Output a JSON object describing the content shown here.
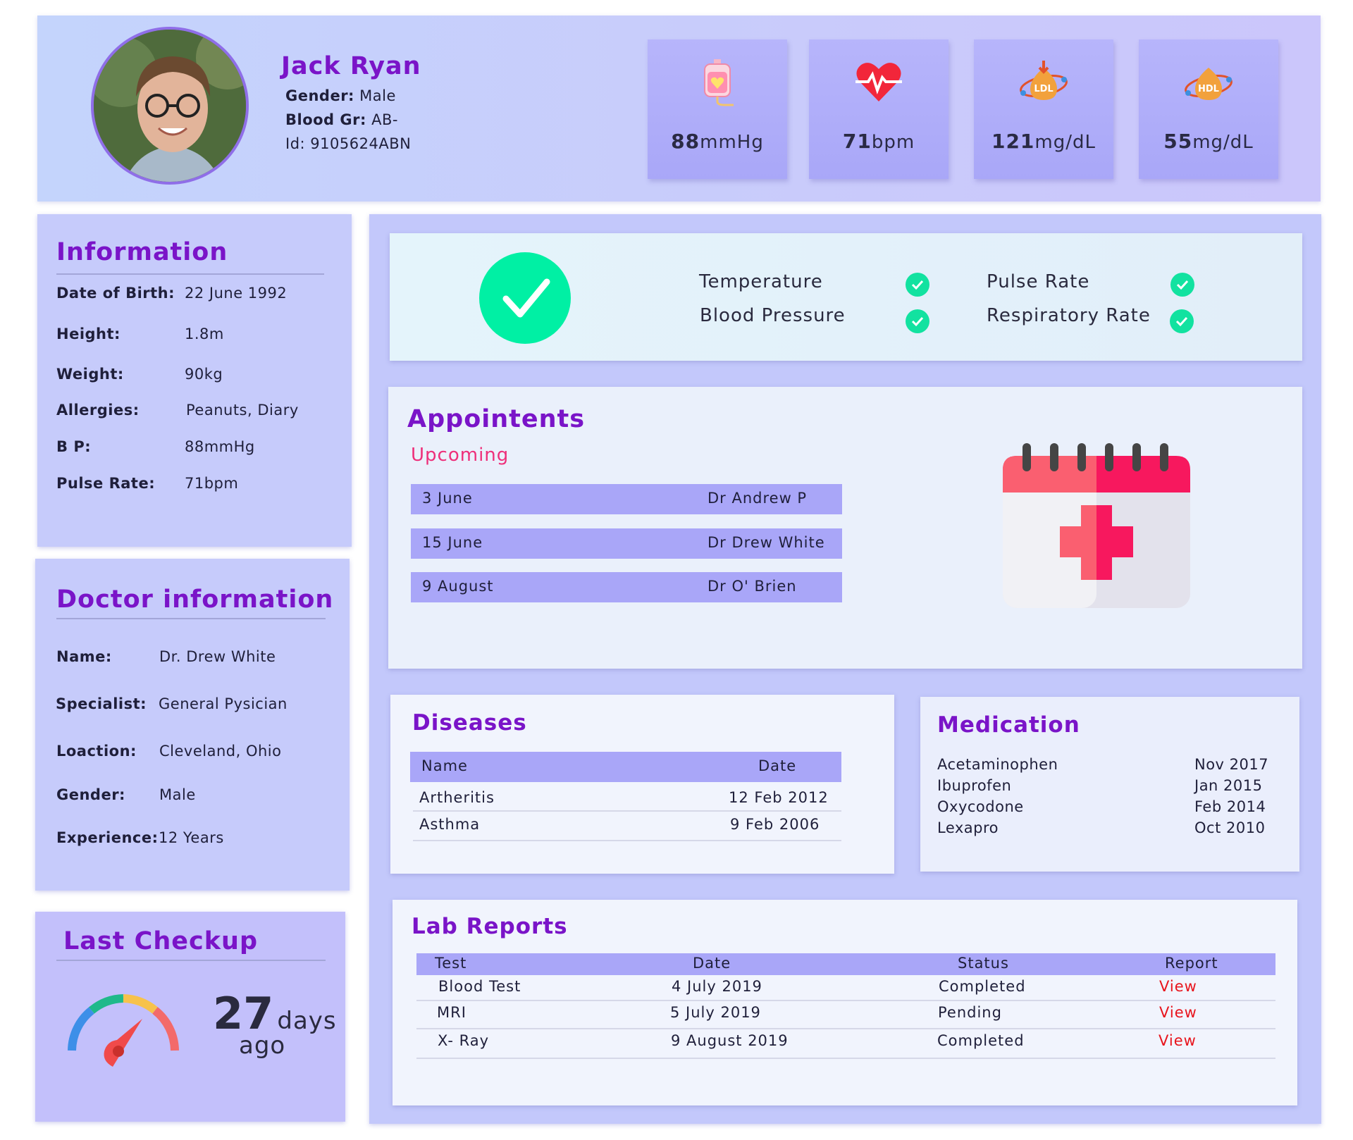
{
  "patient": {
    "name": "Jack Ryan",
    "gender_label": "Gender:",
    "gender": "Male",
    "blood_label": "Blood Gr:",
    "blood_group": "AB-",
    "id_label": "Id:",
    "id": "9105624ABN"
  },
  "vitals": [
    {
      "icon": "blood-bag-icon",
      "value": "88",
      "unit": "mmHg"
    },
    {
      "icon": "heart-pulse-icon",
      "value": "71",
      "unit": "bpm"
    },
    {
      "icon": "ldl-icon",
      "icon_text": "LDL",
      "value": "121",
      "unit": "mg/dL"
    },
    {
      "icon": "hdl-icon",
      "icon_text": "HDL",
      "value": "55",
      "unit": "mg/dL"
    }
  ],
  "information": {
    "title": "Information",
    "rows": [
      {
        "label": "Date of Birth:",
        "value": "22 June 1992"
      },
      {
        "label": "Height:",
        "value": "1.8m"
      },
      {
        "label": "Weight:",
        "value": "90kg"
      },
      {
        "label": "Allergies:",
        "value": "Peanuts, Diary"
      },
      {
        "label": "B P:",
        "value": "88mmHg"
      },
      {
        "label": "Pulse Rate:",
        "value": "71bpm"
      }
    ]
  },
  "doctor": {
    "title": "Doctor information",
    "rows": [
      {
        "label": "Name:",
        "value": "Dr. Drew White"
      },
      {
        "label": "Specialist:",
        "value": "General Pysician"
      },
      {
        "label": "Loaction:",
        "value": "Cleveland, Ohio"
      },
      {
        "label": "Gender:",
        "value": "Male"
      },
      {
        "label": "Experience:",
        "value": "12 Years"
      }
    ]
  },
  "last_checkup": {
    "title": "Last Checkup",
    "days": "27",
    "unit": "days",
    "suffix": "ago"
  },
  "checks": {
    "items": [
      "Temperature",
      "Blood Pressure",
      "Pulse Rate",
      "Respiratory Rate"
    ]
  },
  "appointments": {
    "title": "Appointents",
    "subtitle": "Upcoming",
    "rows": [
      {
        "date": "3 June",
        "doctor": "Dr Andrew P"
      },
      {
        "date": "15 June",
        "doctor": "Dr Drew White"
      },
      {
        "date": "9 August",
        "doctor": "Dr O' Brien"
      }
    ]
  },
  "diseases": {
    "title": "Diseases",
    "columns": [
      "Name",
      "Date"
    ],
    "rows": [
      {
        "name": "Artheritis",
        "date": "12 Feb 2012"
      },
      {
        "name": "Asthma",
        "date": "9 Feb 2006"
      }
    ]
  },
  "medication": {
    "title": "Medication",
    "rows": [
      {
        "name": "Acetaminophen",
        "date": "Nov 2017"
      },
      {
        "name": "Ibuprofen",
        "date": "Jan 2015"
      },
      {
        "name": "Oxycodone",
        "date": "Feb 2014"
      },
      {
        "name": "Lexapro",
        "date": "Oct 2010"
      }
    ]
  },
  "lab_reports": {
    "title": "Lab Reports",
    "columns": [
      "Test",
      "Date",
      "Status",
      "Report"
    ],
    "rows": [
      {
        "test": "Blood Test",
        "date": "4 July 2019",
        "status": "Completed",
        "report": "View"
      },
      {
        "test": "MRI",
        "date": "5 July 2019",
        "status": "Pending",
        "report": "View"
      },
      {
        "test": "X- Ray",
        "date": "9 August 2019",
        "status": "Completed",
        "report": "View"
      }
    ]
  },
  "colors": {
    "title_purple": "#7a14c8",
    "accent_pink": "#ee2f7a",
    "check_green": "#00f0a4",
    "link_red": "#e8141c",
    "row_purple": "#a9a6f8"
  }
}
